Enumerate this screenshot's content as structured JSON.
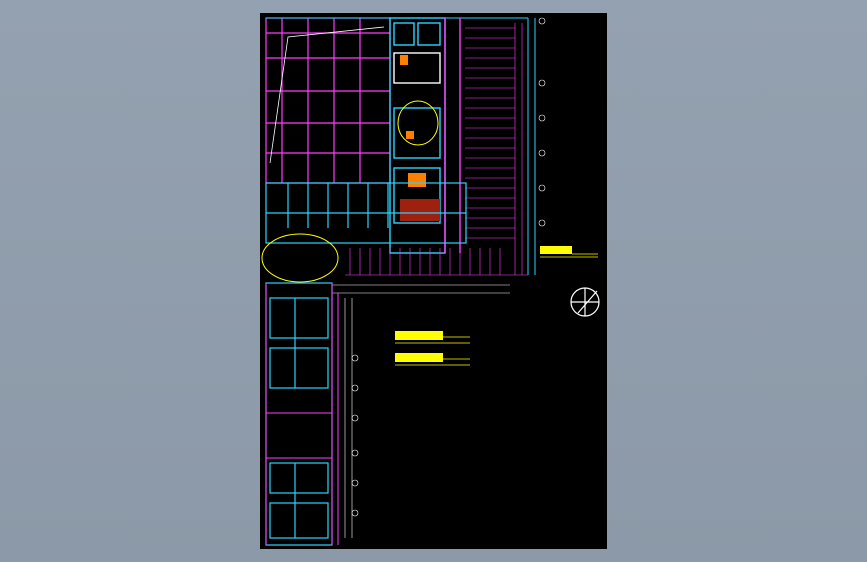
{
  "viewport": {
    "background": "#8f9cab",
    "paper_color": "#000000"
  },
  "drawing": {
    "colors": {
      "wall": "#ff3cff",
      "partition": "#2ad4ff",
      "grid": "#c000c0",
      "annotation": "#ffff00",
      "furniture": "#ff8000",
      "white_line": "#ffffff",
      "ramp": "#ff40ff"
    },
    "north_arrow_icon": "north-arrow-icon",
    "text_blocks": [
      {
        "id": "legend-right"
      },
      {
        "id": "legend-center-1"
      },
      {
        "id": "legend-center-2"
      }
    ]
  }
}
